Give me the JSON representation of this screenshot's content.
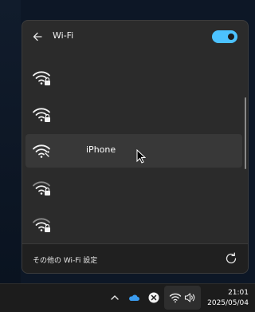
{
  "flyout": {
    "title": "Wi-Fi",
    "wifi_enabled": true,
    "networks": [
      {
        "name": "",
        "secured": true,
        "signal": "full"
      },
      {
        "name": "",
        "secured": true,
        "signal": "full"
      },
      {
        "name": "iPhone",
        "secured": false,
        "signal": "full",
        "hovered": true
      },
      {
        "name": "",
        "secured": true,
        "signal": "medium"
      },
      {
        "name": "",
        "secured": true,
        "signal": "medium"
      }
    ],
    "footer": {
      "more_settings_label": "その他の Wi-Fi 設定"
    },
    "icons": {
      "back": "back-arrow-icon",
      "refresh": "refresh-icon",
      "network": "wifi-icon",
      "lock": "lock-icon"
    }
  },
  "taskbar": {
    "tray_icons": [
      "chevron-up-icon",
      "onedrive-cloud-icon",
      "close-circle-icon",
      "wifi-icon",
      "speaker-icon"
    ],
    "time": "21:01",
    "date": "2025/05/04"
  },
  "colors": {
    "accent": "#4cc2ff",
    "flyout_bg": "#2b2b2b",
    "footer_bg": "#202020",
    "hover_row": "#383838",
    "taskbar_bg": "#1c1c1c"
  }
}
